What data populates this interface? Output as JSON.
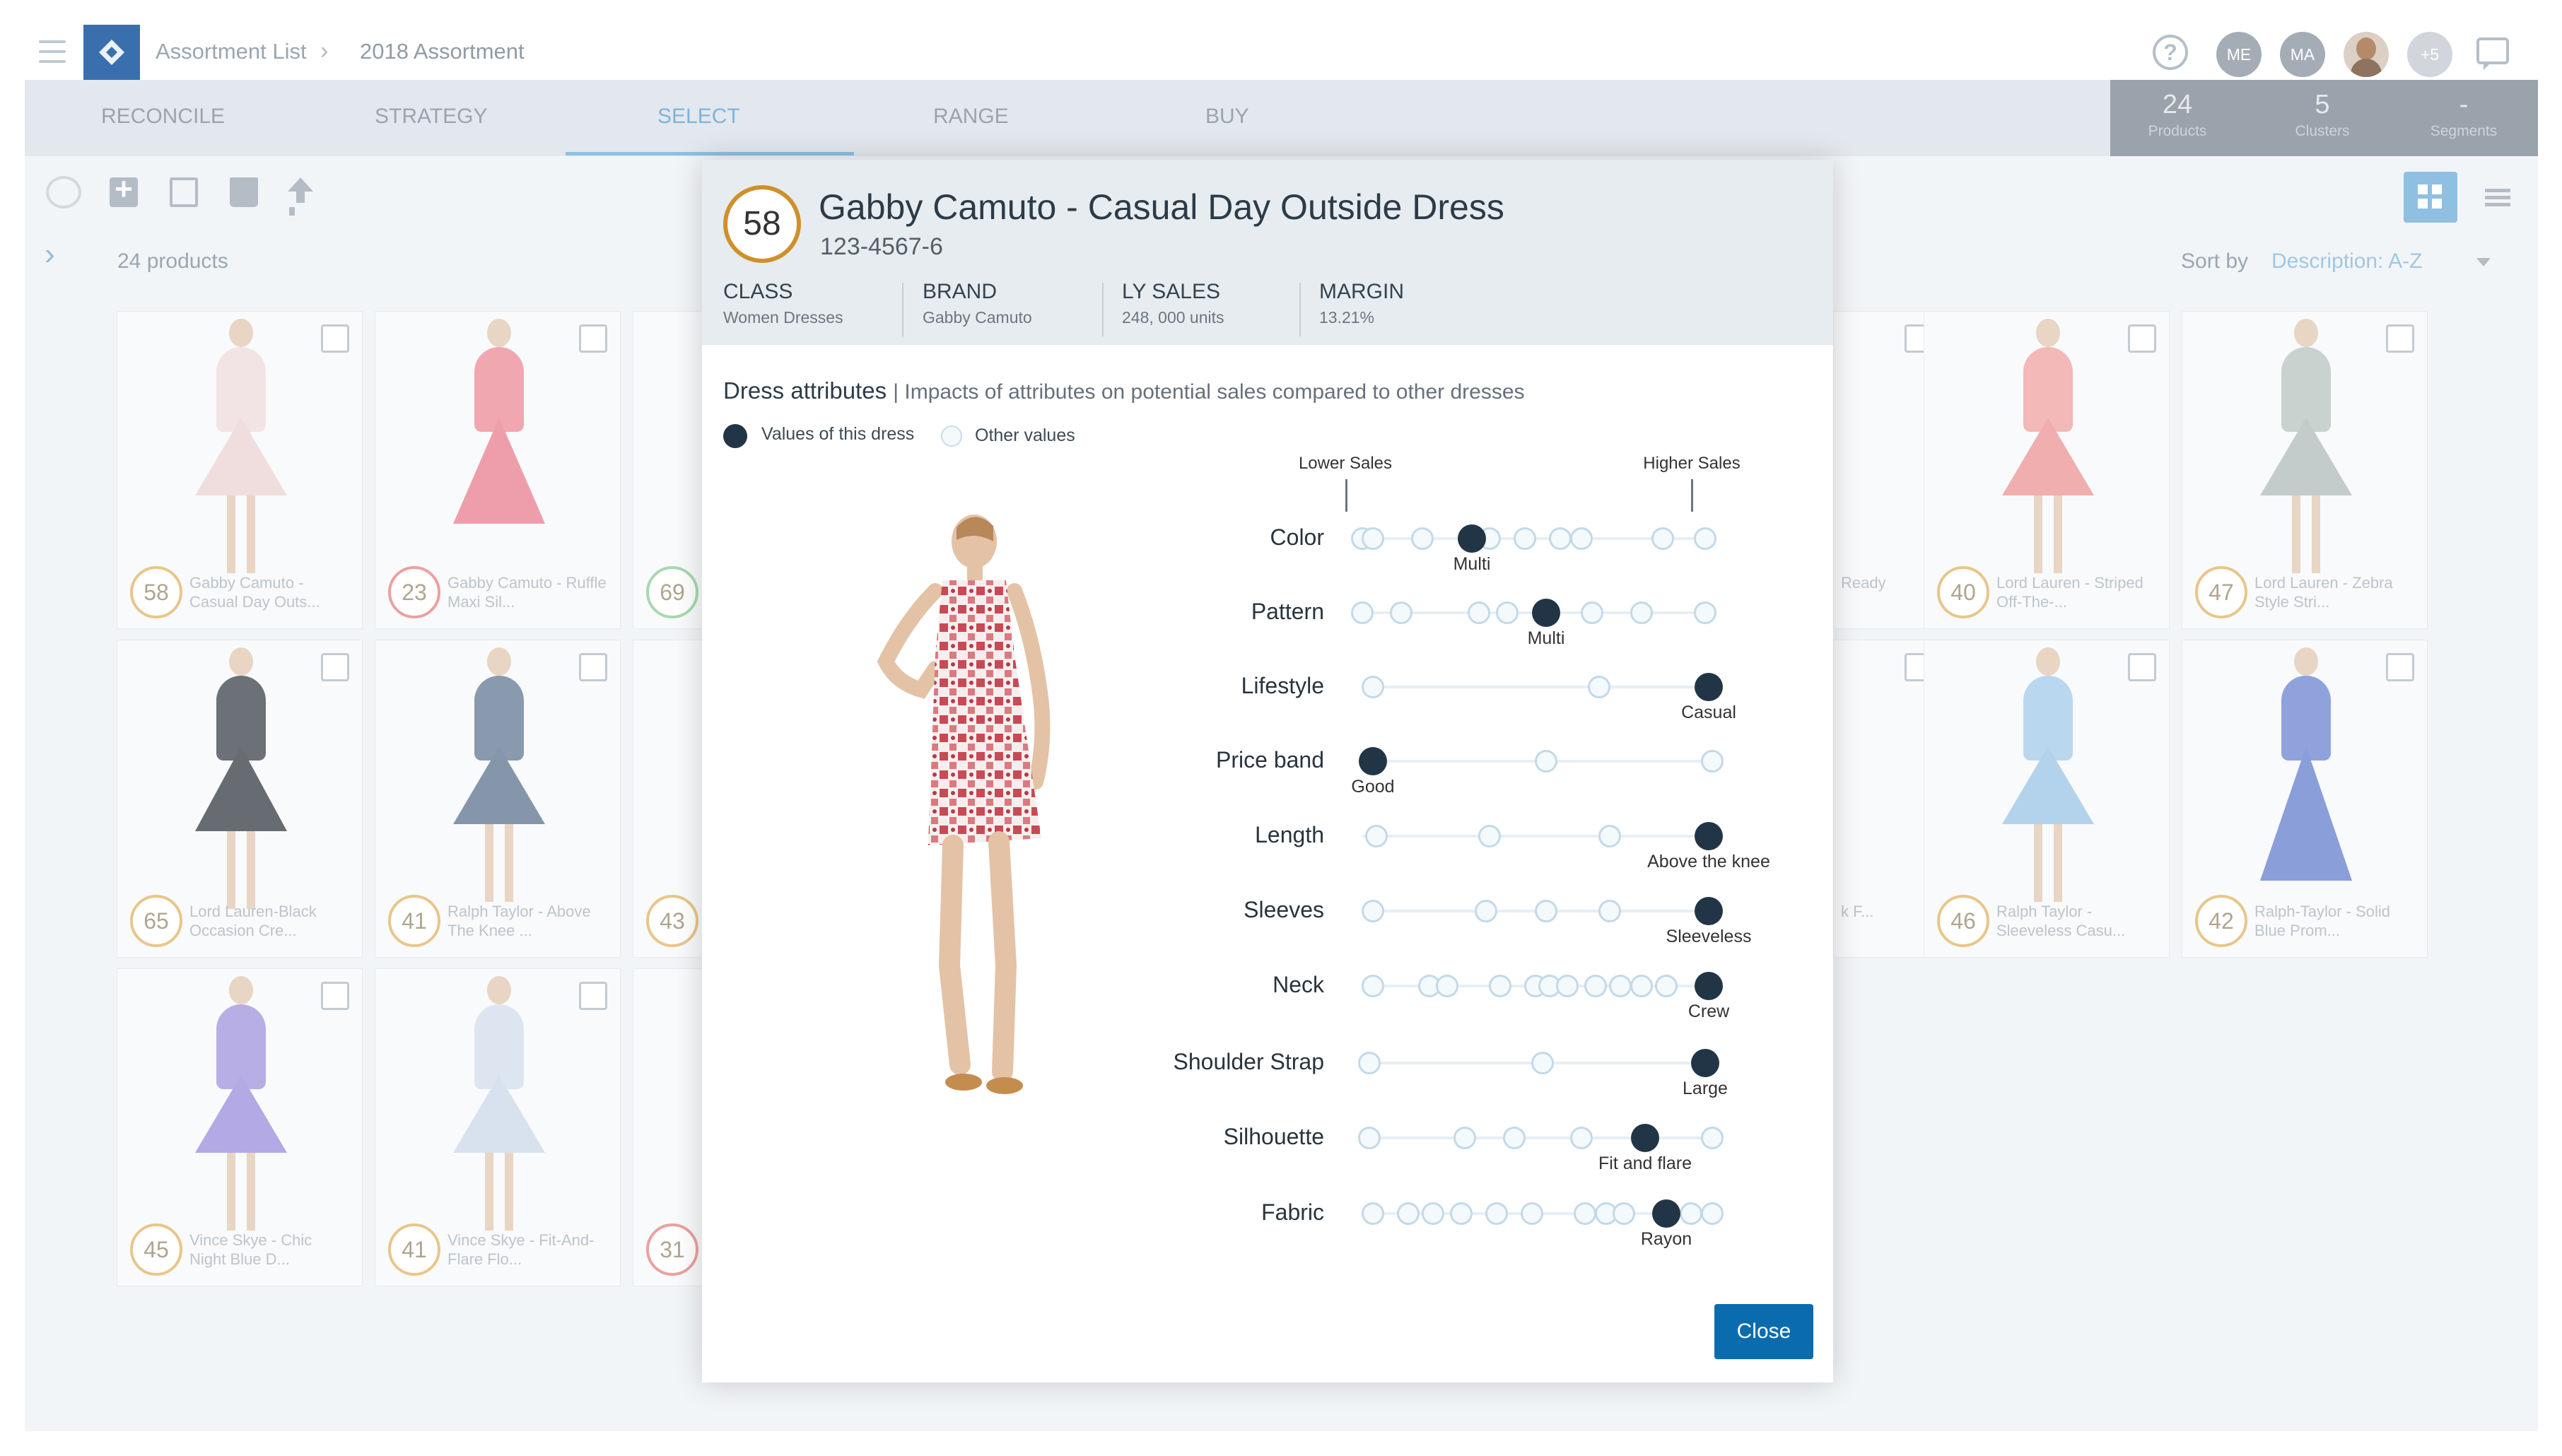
{
  "breadcrumb": {
    "parent": "Assortment List",
    "separator": "›",
    "current": "2018 Assortment"
  },
  "header": {
    "help_icon": "?",
    "avatars": [
      {
        "initials": "ME"
      },
      {
        "initials": "MA"
      },
      {
        "initials": ""
      },
      {
        "initials": "+5"
      }
    ]
  },
  "nav": {
    "tabs": [
      {
        "label": "RECONCILE"
      },
      {
        "label": "STRATEGY"
      },
      {
        "label": "SELECT",
        "active": true
      },
      {
        "label": "RANGE"
      },
      {
        "label": "BUY"
      }
    ]
  },
  "stats": {
    "products": {
      "value": "24",
      "label": "Products"
    },
    "clusters": {
      "value": "5",
      "label": "Clusters"
    },
    "segments": {
      "value": "-",
      "label": "Segments"
    }
  },
  "list": {
    "count_label": "24 products",
    "sort_label": "Sort by",
    "sort_value": "Description: A-Z"
  },
  "cards": [
    {
      "score": "58",
      "name": "Gabby Camuto - Casual Day Outs..."
    },
    {
      "score": "23",
      "name": "Gabby Camuto - Ruffle Maxi Sil..."
    },
    {
      "score": "69",
      "name": ""
    },
    {
      "score": "65",
      "name": "Lord Lauren-Black Occasion Cre..."
    },
    {
      "score": "41",
      "name": "Ralph Taylor - Above The Knee ..."
    },
    {
      "score": "43",
      "name": ""
    },
    {
      "score": "45",
      "name": "Vince Skye - Chic Night Blue D..."
    },
    {
      "score": "41",
      "name": "Vince Skye - Fit-And-Flare Flo..."
    },
    {
      "score": "31",
      "name": ""
    },
    {
      "score": "",
      "name": "Ready"
    },
    {
      "score": "40",
      "name": "Lord Lauren - Striped Off-The-..."
    },
    {
      "score": "47",
      "name": "Lord Lauren - Zebra Style Stri..."
    },
    {
      "score": "",
      "name": "k F..."
    },
    {
      "score": "46",
      "name": "Ralph Taylor - Sleeveless Casu..."
    },
    {
      "score": "42",
      "name": "Ralph-Taylor - Solid Blue Prom..."
    }
  ],
  "modal": {
    "score": "58",
    "title": "Gabby Camuto - Casual Day Outside Dress",
    "sku": "123-4567-6",
    "meta": [
      {
        "key": "CLASS",
        "value": "Women Dresses"
      },
      {
        "key": "BRAND",
        "value": "Gabby Camuto"
      },
      {
        "key": "LY SALES",
        "value": "248, 000 units"
      },
      {
        "key": "MARGIN",
        "value": "13.21%"
      }
    ],
    "attributes_heading": "Dress attributes",
    "attributes_subheading": "| Impacts of attributes on potential sales compared to other dresses",
    "legend": {
      "this": "Values of this dress",
      "other": "Other values"
    },
    "scale": {
      "lower": "Lower Sales",
      "higher": "Higher Sales"
    },
    "attributes": [
      {
        "label": "Color",
        "selected": "Multi",
        "selected_pos": 0.31,
        "others": [
          0.0,
          0.03,
          0.17,
          0.36,
          0.46,
          0.56,
          0.62,
          0.85,
          0.97
        ]
      },
      {
        "label": "Pattern",
        "selected": "Multi",
        "selected_pos": 0.52,
        "others": [
          0.0,
          0.11,
          0.33,
          0.41,
          0.65,
          0.79,
          0.97
        ]
      },
      {
        "label": "Lifestyle",
        "selected": "Casual",
        "selected_pos": 0.98,
        "others": [
          0.03,
          0.67
        ]
      },
      {
        "label": "Price band",
        "selected": "Good",
        "selected_pos": 0.03,
        "others": [
          0.52,
          0.99
        ]
      },
      {
        "label": "Length",
        "selected": "Above the knee",
        "selected_pos": 0.98,
        "others": [
          0.04,
          0.36,
          0.7
        ]
      },
      {
        "label": "Sleeves",
        "selected": "Sleeveless",
        "selected_pos": 0.98,
        "others": [
          0.03,
          0.35,
          0.52,
          0.7
        ]
      },
      {
        "label": "Neck",
        "selected": "Crew",
        "selected_pos": 0.98,
        "others": [
          0.03,
          0.19,
          0.24,
          0.39,
          0.49,
          0.53,
          0.58,
          0.66,
          0.73,
          0.79,
          0.86
        ]
      },
      {
        "label": "Shoulder Strap",
        "selected": "Large",
        "selected_pos": 0.97,
        "others": [
          0.02,
          0.51
        ]
      },
      {
        "label": "Silhouette",
        "selected": "Fit and flare",
        "selected_pos": 0.8,
        "others": [
          0.02,
          0.29,
          0.43,
          0.62,
          0.99
        ]
      },
      {
        "label": "Fabric",
        "selected": "Rayon",
        "selected_pos": 0.86,
        "others": [
          0.03,
          0.13,
          0.2,
          0.28,
          0.38,
          0.48,
          0.63,
          0.69,
          0.74,
          0.93,
          0.99
        ]
      }
    ],
    "close_label": "Close"
  },
  "colors": {
    "accent": "#0a6cae",
    "selected_dot": "#223546",
    "score_ring": "#cf902c"
  },
  "icons": [
    "menu-icon",
    "logo-icon",
    "chevron-right-icon",
    "help-icon",
    "chat-icon",
    "refresh-icon",
    "add-icon",
    "copy-icon",
    "trash-icon",
    "upload-icon",
    "grid-view-icon",
    "list-view-icon",
    "chevron-down-icon"
  ]
}
